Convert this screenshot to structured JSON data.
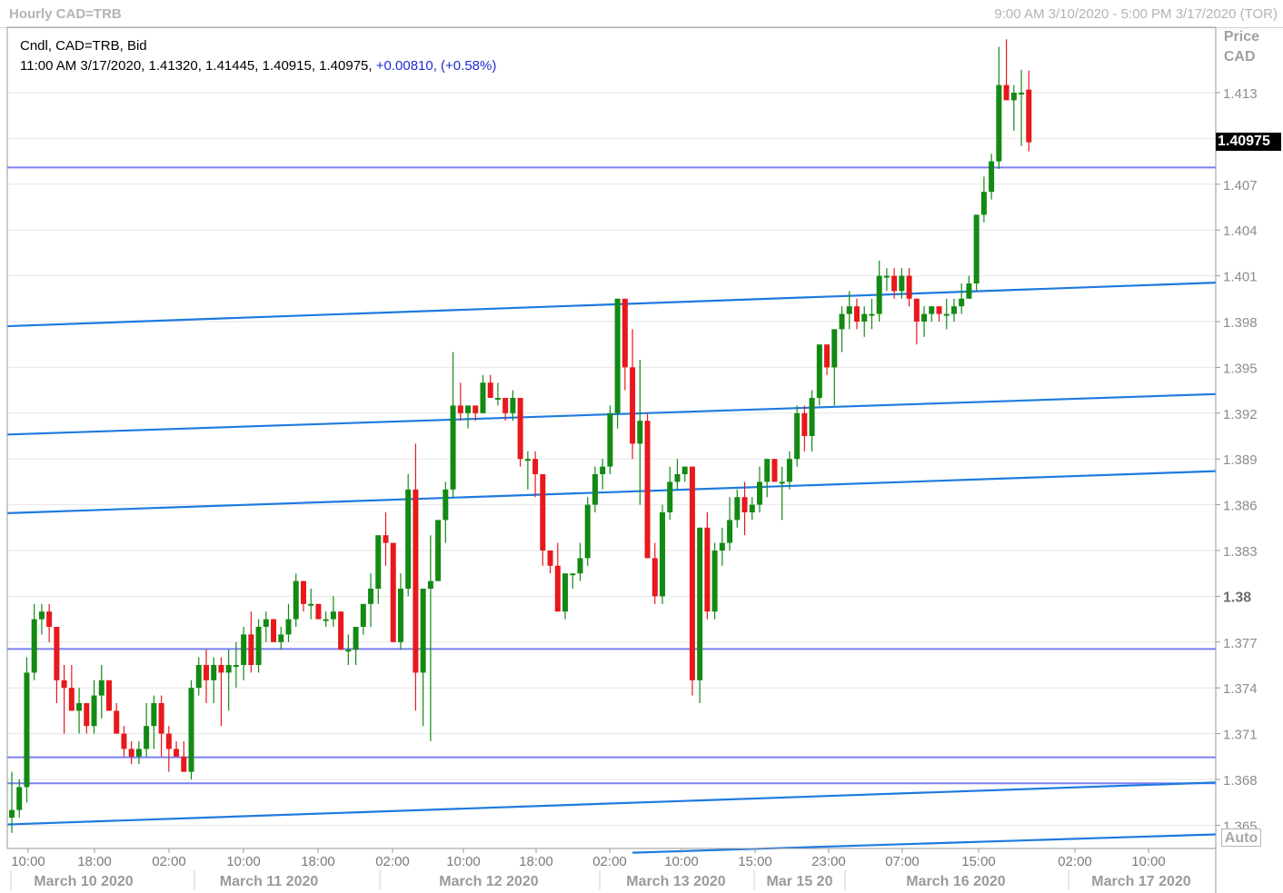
{
  "window": {
    "title": "Hourly CAD=TRB",
    "range": "9:00 AM 3/10/2020 - 5:00 PM 3/17/2020 (TOR)"
  },
  "info": {
    "line1": "Cndl, CAD=TRB, Bid",
    "line2_values": "11:00 AM 3/17/2020, 1.41320, 1.41445, 1.40915, 1.40975,",
    "line2_change": "+0.00810, (+0.58%)"
  },
  "price_axis": {
    "title_line1": "Price",
    "title_line2": "CAD",
    "last_price": "1.40975",
    "auto_label": "Auto"
  },
  "colors": {
    "up": "#138a13",
    "down": "#e8181c",
    "trendline": "#1e7ae0",
    "level": "#7a7ef0",
    "grid": "#e6e6e6"
  },
  "chart_data": {
    "type": "candlestick",
    "title": "Hourly CAD=TRB",
    "ylabel": "Price CAD",
    "ylim": [
      1.3635,
      1.4155
    ],
    "y_ticks": [
      "1.365",
      "1.368",
      "1.371",
      "1.374",
      "1.377",
      "1.38",
      "1.383",
      "1.386",
      "1.389",
      "1.392",
      "1.395",
      "1.398",
      "1.401",
      "1.404",
      "1.407",
      "1.41",
      "1.413"
    ],
    "y_ticks_shown": [
      "1.365",
      "1.368",
      "1.371",
      "1.374",
      "1.377",
      "1.38",
      "1.383",
      "1.386",
      "1.389",
      "1.392",
      "1.395",
      "1.398",
      "1.401",
      "1.404",
      "1.407",
      "1.413"
    ],
    "time_labels": [
      "10:00",
      "18:00",
      "02:00",
      "10:00",
      "18:00",
      "02:00",
      "10:00",
      "18:00",
      "02:00",
      "10:00",
      "15:00",
      "23:00",
      "07:00",
      "15:00",
      "02:00",
      "10:00"
    ],
    "date_labels": [
      "March 10 2020",
      "March 11 2020",
      "March 12 2020",
      "March 13 2020",
      "Mar 15 20",
      "March 16 2020",
      "March 17 2020"
    ],
    "candles": [
      {
        "o": 1.3655,
        "h": 1.3685,
        "l": 1.3645,
        "c": 1.366
      },
      {
        "o": 1.366,
        "h": 1.368,
        "l": 1.3655,
        "c": 1.3675
      },
      {
        "o": 1.3675,
        "h": 1.376,
        "l": 1.3665,
        "c": 1.375
      },
      {
        "o": 1.375,
        "h": 1.3795,
        "l": 1.3745,
        "c": 1.3785
      },
      {
        "o": 1.3785,
        "h": 1.3795,
        "l": 1.3775,
        "c": 1.379
      },
      {
        "o": 1.379,
        "h": 1.3795,
        "l": 1.377,
        "c": 1.378
      },
      {
        "o": 1.378,
        "h": 1.378,
        "l": 1.373,
        "c": 1.3745
      },
      {
        "o": 1.3745,
        "h": 1.3755,
        "l": 1.371,
        "c": 1.374
      },
      {
        "o": 1.374,
        "h": 1.3755,
        "l": 1.3725,
        "c": 1.3725
      },
      {
        "o": 1.3725,
        "h": 1.374,
        "l": 1.371,
        "c": 1.373
      },
      {
        "o": 1.373,
        "h": 1.373,
        "l": 1.371,
        "c": 1.3715
      },
      {
        "o": 1.3715,
        "h": 1.3745,
        "l": 1.371,
        "c": 1.3735
      },
      {
        "o": 1.3735,
        "h": 1.3755,
        "l": 1.372,
        "c": 1.3745
      },
      {
        "o": 1.3745,
        "h": 1.3745,
        "l": 1.3725,
        "c": 1.3725
      },
      {
        "o": 1.3725,
        "h": 1.373,
        "l": 1.371,
        "c": 1.371
      },
      {
        "o": 1.371,
        "h": 1.3715,
        "l": 1.3695,
        "c": 1.37
      },
      {
        "o": 1.37,
        "h": 1.3705,
        "l": 1.369,
        "c": 1.3695
      },
      {
        "o": 1.3695,
        "h": 1.3705,
        "l": 1.369,
        "c": 1.37
      },
      {
        "o": 1.37,
        "h": 1.373,
        "l": 1.3695,
        "c": 1.3715
      },
      {
        "o": 1.3715,
        "h": 1.3735,
        "l": 1.37,
        "c": 1.373
      },
      {
        "o": 1.373,
        "h": 1.3735,
        "l": 1.3695,
        "c": 1.371
      },
      {
        "o": 1.371,
        "h": 1.3715,
        "l": 1.3685,
        "c": 1.37
      },
      {
        "o": 1.37,
        "h": 1.3705,
        "l": 1.3695,
        "c": 1.3695
      },
      {
        "o": 1.3695,
        "h": 1.3705,
        "l": 1.3685,
        "c": 1.3685
      },
      {
        "o": 1.3685,
        "h": 1.3745,
        "l": 1.368,
        "c": 1.374
      },
      {
        "o": 1.374,
        "h": 1.376,
        "l": 1.3735,
        "c": 1.3755
      },
      {
        "o": 1.3755,
        "h": 1.3765,
        "l": 1.373,
        "c": 1.3745
      },
      {
        "o": 1.3745,
        "h": 1.376,
        "l": 1.373,
        "c": 1.3755
      },
      {
        "o": 1.3755,
        "h": 1.376,
        "l": 1.3715,
        "c": 1.375
      },
      {
        "o": 1.375,
        "h": 1.3765,
        "l": 1.3725,
        "c": 1.3755
      },
      {
        "o": 1.3755,
        "h": 1.377,
        "l": 1.374,
        "c": 1.3755
      },
      {
        "o": 1.3755,
        "h": 1.378,
        "l": 1.3745,
        "c": 1.3775
      },
      {
        "o": 1.3775,
        "h": 1.379,
        "l": 1.375,
        "c": 1.3755
      },
      {
        "o": 1.3755,
        "h": 1.3785,
        "l": 1.375,
        "c": 1.378
      },
      {
        "o": 1.378,
        "h": 1.379,
        "l": 1.377,
        "c": 1.3785
      },
      {
        "o": 1.3785,
        "h": 1.3785,
        "l": 1.377,
        "c": 1.377
      },
      {
        "o": 1.377,
        "h": 1.378,
        "l": 1.3765,
        "c": 1.3775
      },
      {
        "o": 1.3775,
        "h": 1.3795,
        "l": 1.377,
        "c": 1.3785
      },
      {
        "o": 1.3785,
        "h": 1.3815,
        "l": 1.378,
        "c": 1.381
      },
      {
        "o": 1.381,
        "h": 1.381,
        "l": 1.379,
        "c": 1.3795
      },
      {
        "o": 1.3795,
        "h": 1.3805,
        "l": 1.3785,
        "c": 1.3795
      },
      {
        "o": 1.3795,
        "h": 1.3795,
        "l": 1.3785,
        "c": 1.3785
      },
      {
        "o": 1.3785,
        "h": 1.379,
        "l": 1.378,
        "c": 1.3785
      },
      {
        "o": 1.3785,
        "h": 1.38,
        "l": 1.378,
        "c": 1.379
      },
      {
        "o": 1.379,
        "h": 1.379,
        "l": 1.3765,
        "c": 1.3765
      },
      {
        "o": 1.3765,
        "h": 1.3775,
        "l": 1.3755,
        "c": 1.3765
      },
      {
        "o": 1.3765,
        "h": 1.378,
        "l": 1.3755,
        "c": 1.378
      },
      {
        "o": 1.378,
        "h": 1.3795,
        "l": 1.3775,
        "c": 1.3795
      },
      {
        "o": 1.3795,
        "h": 1.3815,
        "l": 1.378,
        "c": 1.3805
      },
      {
        "o": 1.3805,
        "h": 1.384,
        "l": 1.3795,
        "c": 1.384
      },
      {
        "o": 1.384,
        "h": 1.3855,
        "l": 1.382,
        "c": 1.3835
      },
      {
        "o": 1.3835,
        "h": 1.3835,
        "l": 1.377,
        "c": 1.377
      },
      {
        "o": 1.377,
        "h": 1.3815,
        "l": 1.3765,
        "c": 1.3805
      },
      {
        "o": 1.3805,
        "h": 1.388,
        "l": 1.38,
        "c": 1.387
      },
      {
        "o": 1.387,
        "h": 1.39,
        "l": 1.3725,
        "c": 1.375
      },
      {
        "o": 1.375,
        "h": 1.3805,
        "l": 1.3715,
        "c": 1.3805
      },
      {
        "o": 1.3805,
        "h": 1.384,
        "l": 1.3705,
        "c": 1.381
      },
      {
        "o": 1.381,
        "h": 1.385,
        "l": 1.381,
        "c": 1.385
      },
      {
        "o": 1.385,
        "h": 1.3875,
        "l": 1.3835,
        "c": 1.387
      },
      {
        "o": 1.387,
        "h": 1.396,
        "l": 1.3865,
        "c": 1.3925
      },
      {
        "o": 1.3925,
        "h": 1.394,
        "l": 1.3915,
        "c": 1.392
      },
      {
        "o": 1.392,
        "h": 1.3925,
        "l": 1.391,
        "c": 1.3925
      },
      {
        "o": 1.3925,
        "h": 1.3925,
        "l": 1.3915,
        "c": 1.392
      },
      {
        "o": 1.392,
        "h": 1.3945,
        "l": 1.392,
        "c": 1.394
      },
      {
        "o": 1.394,
        "h": 1.3945,
        "l": 1.393,
        "c": 1.393
      },
      {
        "o": 1.393,
        "h": 1.394,
        "l": 1.3925,
        "c": 1.393
      },
      {
        "o": 1.393,
        "h": 1.393,
        "l": 1.3915,
        "c": 1.392
      },
      {
        "o": 1.392,
        "h": 1.3935,
        "l": 1.3915,
        "c": 1.393
      },
      {
        "o": 1.393,
        "h": 1.393,
        "l": 1.3885,
        "c": 1.389
      },
      {
        "o": 1.389,
        "h": 1.3895,
        "l": 1.387,
        "c": 1.389
      },
      {
        "o": 1.389,
        "h": 1.3895,
        "l": 1.3865,
        "c": 1.388
      },
      {
        "o": 1.388,
        "h": 1.388,
        "l": 1.382,
        "c": 1.383
      },
      {
        "o": 1.383,
        "h": 1.383,
        "l": 1.3815,
        "c": 1.382
      },
      {
        "o": 1.382,
        "h": 1.3835,
        "l": 1.379,
        "c": 1.379
      },
      {
        "o": 1.379,
        "h": 1.3815,
        "l": 1.3785,
        "c": 1.3815
      },
      {
        "o": 1.3815,
        "h": 1.3815,
        "l": 1.3805,
        "c": 1.3815
      },
      {
        "o": 1.3815,
        "h": 1.3835,
        "l": 1.381,
        "c": 1.3825
      },
      {
        "o": 1.3825,
        "h": 1.3865,
        "l": 1.382,
        "c": 1.386
      },
      {
        "o": 1.386,
        "h": 1.3885,
        "l": 1.3855,
        "c": 1.388
      },
      {
        "o": 1.388,
        "h": 1.389,
        "l": 1.387,
        "c": 1.3885
      },
      {
        "o": 1.3885,
        "h": 1.3925,
        "l": 1.388,
        "c": 1.392
      },
      {
        "o": 1.392,
        "h": 1.3995,
        "l": 1.391,
        "c": 1.3995
      },
      {
        "o": 1.3995,
        "h": 1.3995,
        "l": 1.3935,
        "c": 1.395
      },
      {
        "o": 1.395,
        "h": 1.3975,
        "l": 1.389,
        "c": 1.39
      },
      {
        "o": 1.39,
        "h": 1.3955,
        "l": 1.386,
        "c": 1.3915
      },
      {
        "o": 1.3915,
        "h": 1.392,
        "l": 1.3825,
        "c": 1.3825
      },
      {
        "o": 1.3825,
        "h": 1.3835,
        "l": 1.3795,
        "c": 1.38
      },
      {
        "o": 1.38,
        "h": 1.386,
        "l": 1.3795,
        "c": 1.3855
      },
      {
        "o": 1.3855,
        "h": 1.3885,
        "l": 1.385,
        "c": 1.3875
      },
      {
        "o": 1.3875,
        "h": 1.389,
        "l": 1.387,
        "c": 1.388
      },
      {
        "o": 1.388,
        "h": 1.3885,
        "l": 1.3875,
        "c": 1.3885
      },
      {
        "o": 1.3885,
        "h": 1.3885,
        "l": 1.3735,
        "c": 1.3745
      },
      {
        "o": 1.3745,
        "h": 1.3845,
        "l": 1.373,
        "c": 1.3845
      },
      {
        "o": 1.3845,
        "h": 1.3855,
        "l": 1.3785,
        "c": 1.379
      },
      {
        "o": 1.379,
        "h": 1.3835,
        "l": 1.3785,
        "c": 1.383
      },
      {
        "o": 1.383,
        "h": 1.3845,
        "l": 1.382,
        "c": 1.3835
      },
      {
        "o": 1.3835,
        "h": 1.3865,
        "l": 1.383,
        "c": 1.385
      },
      {
        "o": 1.385,
        "h": 1.387,
        "l": 1.3845,
        "c": 1.3865
      },
      {
        "o": 1.3865,
        "h": 1.3875,
        "l": 1.384,
        "c": 1.3855
      },
      {
        "o": 1.3855,
        "h": 1.3865,
        "l": 1.385,
        "c": 1.386
      },
      {
        "o": 1.386,
        "h": 1.3885,
        "l": 1.3855,
        "c": 1.3875
      },
      {
        "o": 1.3875,
        "h": 1.389,
        "l": 1.3865,
        "c": 1.389
      },
      {
        "o": 1.389,
        "h": 1.389,
        "l": 1.3875,
        "c": 1.3875
      },
      {
        "o": 1.3875,
        "h": 1.3885,
        "l": 1.385,
        "c": 1.3875
      },
      {
        "o": 1.3875,
        "h": 1.3895,
        "l": 1.387,
        "c": 1.389
      },
      {
        "o": 1.389,
        "h": 1.3925,
        "l": 1.3885,
        "c": 1.392
      },
      {
        "o": 1.392,
        "h": 1.3925,
        "l": 1.3895,
        "c": 1.3905
      },
      {
        "o": 1.3905,
        "h": 1.3935,
        "l": 1.3895,
        "c": 1.393
      },
      {
        "o": 1.393,
        "h": 1.3965,
        "l": 1.3925,
        "c": 1.3965
      },
      {
        "o": 1.3965,
        "h": 1.3965,
        "l": 1.3945,
        "c": 1.395
      },
      {
        "o": 1.395,
        "h": 1.3975,
        "l": 1.3925,
        "c": 1.3975
      },
      {
        "o": 1.3975,
        "h": 1.399,
        "l": 1.396,
        "c": 1.3985
      },
      {
        "o": 1.3985,
        "h": 1.4,
        "l": 1.3975,
        "c": 1.399
      },
      {
        "o": 1.399,
        "h": 1.3995,
        "l": 1.3975,
        "c": 1.398
      },
      {
        "o": 1.398,
        "h": 1.399,
        "l": 1.397,
        "c": 1.3985
      },
      {
        "o": 1.3985,
        "h": 1.3995,
        "l": 1.3975,
        "c": 1.3985
      },
      {
        "o": 1.3985,
        "h": 1.402,
        "l": 1.398,
        "c": 1.401
      },
      {
        "o": 1.401,
        "h": 1.4015,
        "l": 1.4,
        "c": 1.401
      },
      {
        "o": 1.401,
        "h": 1.4015,
        "l": 1.3995,
        "c": 1.4
      },
      {
        "o": 1.4,
        "h": 1.4015,
        "l": 1.3995,
        "c": 1.401
      },
      {
        "o": 1.401,
        "h": 1.4015,
        "l": 1.399,
        "c": 1.3995
      },
      {
        "o": 1.3995,
        "h": 1.3995,
        "l": 1.3965,
        "c": 1.398
      },
      {
        "o": 1.398,
        "h": 1.399,
        "l": 1.397,
        "c": 1.3985
      },
      {
        "o": 1.3985,
        "h": 1.399,
        "l": 1.398,
        "c": 1.399
      },
      {
        "o": 1.399,
        "h": 1.399,
        "l": 1.398,
        "c": 1.3985
      },
      {
        "o": 1.3985,
        "h": 1.3995,
        "l": 1.3975,
        "c": 1.3985
      },
      {
        "o": 1.3985,
        "h": 1.3995,
        "l": 1.398,
        "c": 1.399
      },
      {
        "o": 1.399,
        "h": 1.4005,
        "l": 1.3985,
        "c": 1.3995
      },
      {
        "o": 1.3995,
        "h": 1.401,
        "l": 1.3995,
        "c": 1.4005
      },
      {
        "o": 1.4005,
        "h": 1.405,
        "l": 1.4,
        "c": 1.405
      },
      {
        "o": 1.405,
        "h": 1.4075,
        "l": 1.4045,
        "c": 1.4065
      },
      {
        "o": 1.4065,
        "h": 1.409,
        "l": 1.406,
        "c": 1.4085
      },
      {
        "o": 1.4085,
        "h": 1.416,
        "l": 1.408,
        "c": 1.4135
      },
      {
        "o": 1.4135,
        "h": 1.4165,
        "l": 1.4125,
        "c": 1.4125
      },
      {
        "o": 1.4125,
        "h": 1.4135,
        "l": 1.4105,
        "c": 1.413
      },
      {
        "o": 1.413,
        "h": 1.4145,
        "l": 1.4095,
        "c": 1.413
      },
      {
        "o": 1.4132,
        "h": 1.41445,
        "l": 1.40915,
        "c": 1.40975
      }
    ],
    "level_lines": [
      1.4081,
      1.37655,
      1.36945,
      1.36775
    ],
    "trend_lines": [
      {
        "x1": 0,
        "y1": 1.3977,
        "x2": 139,
        "y2": 1.40055
      },
      {
        "x1": 0,
        "y1": 1.3906,
        "x2": 139,
        "y2": 1.39325
      },
      {
        "x1": 0,
        "y1": 1.38545,
        "x2": 139,
        "y2": 1.3882
      },
      {
        "x1": 0,
        "y1": 1.36505,
        "x2": 139,
        "y2": 1.3678
      },
      {
        "x1": 83,
        "y1": 1.3632,
        "x2": 139,
        "y2": 1.3644
      }
    ]
  }
}
